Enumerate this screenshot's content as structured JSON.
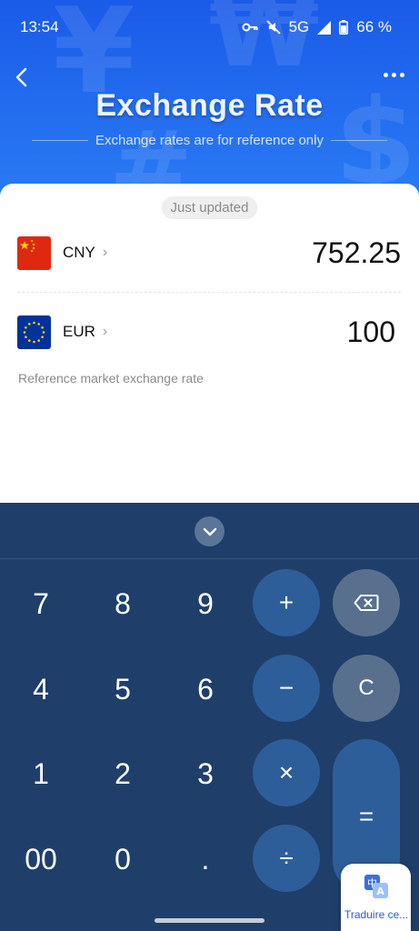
{
  "status_bar": {
    "time": "13:54",
    "network": "5G",
    "battery": "66 %"
  },
  "header": {
    "title": "Exchange Rate",
    "subtitle": "Exchange rates are for reference only",
    "back_icon": "chevron-left-icon",
    "more_icon": "more-horizontal-icon"
  },
  "converter": {
    "updated_label": "Just updated",
    "rows": [
      {
        "code": "CNY",
        "amount": "752.25",
        "flag": "china-flag"
      },
      {
        "code": "EUR",
        "amount": "100",
        "flag": "eu-flag"
      }
    ],
    "note": "Reference market exchange rate"
  },
  "keypad": {
    "digits": [
      "7",
      "8",
      "9",
      "4",
      "5",
      "6",
      "1",
      "2",
      "3",
      "00",
      "0",
      "."
    ],
    "ops": {
      "plus": "+",
      "minus": "−",
      "times": "×",
      "divide": "÷",
      "equals": "=",
      "clear": "C"
    }
  },
  "translate_widget": {
    "label": "Traduire ce..."
  },
  "colors": {
    "header_blue": "#1a5be8",
    "pad_bg": "#1f3f6a",
    "op_button": "#2e5e99",
    "gray_button": "#58708e"
  }
}
